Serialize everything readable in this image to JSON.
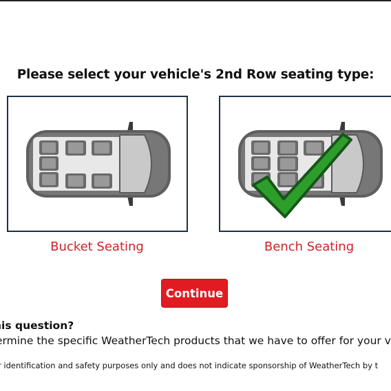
{
  "heading": "Please select your vehicle's 2nd Row seating type:",
  "options": [
    {
      "label": "Bucket Seating",
      "selected": false,
      "image": "van-top-view-bucket-seats"
    },
    {
      "label": "Bench Seating",
      "selected": true,
      "image": "van-top-view-bench-seat"
    }
  ],
  "continue_label": "Continue",
  "info": {
    "title": "his question?",
    "body": "ermine the specific WeatherTech products that we have to offer for your veh",
    "disclaimer": "r identification and safety purposes only and does not indicate sponsorship of WeatherTech by t"
  },
  "colors": {
    "accent_red": "#e01b22",
    "label_red": "#cc2229",
    "card_border": "#1d3045",
    "checkmark_green": "#2e9e2b"
  }
}
